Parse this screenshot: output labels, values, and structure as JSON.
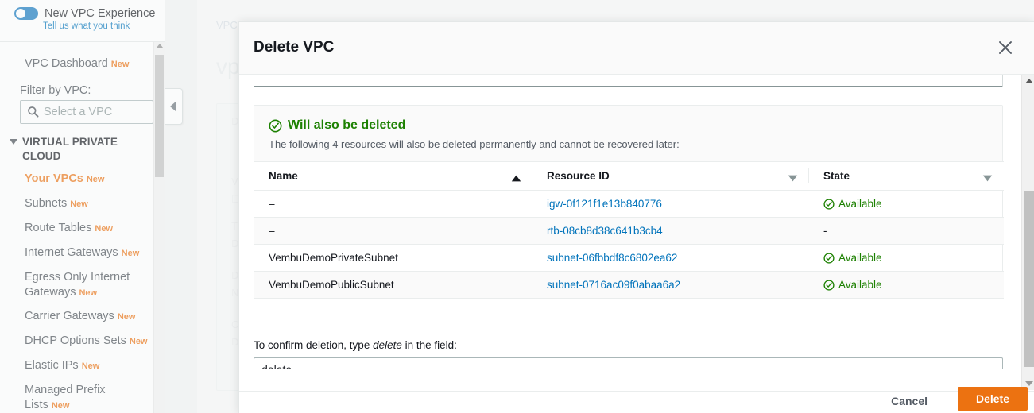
{
  "sidebar": {
    "new_experience": {
      "label": "New VPC Experience",
      "feedback_link": "Tell us what you think",
      "toggle_on": true,
      "toggle_color": "#1076bd"
    },
    "dashboard": {
      "label": "VPC Dashboard",
      "badge": "New"
    },
    "filter": {
      "label": "Filter by VPC:",
      "placeholder": "Select a VPC",
      "value": ""
    },
    "group": {
      "label": "VIRTUAL PRIVATE CLOUD"
    },
    "items": [
      {
        "label": "Your VPCs",
        "badge": "New",
        "selected": true
      },
      {
        "label": "Subnets",
        "badge": "New",
        "selected": false
      },
      {
        "label": "Route Tables",
        "badge": "New",
        "selected": false
      },
      {
        "label": "Internet Gateways",
        "badge": "New",
        "selected": false
      },
      {
        "label": "Egress Only Internet Gateways",
        "badge": "New",
        "selected": false
      },
      {
        "label": "Carrier Gateways",
        "badge": "New",
        "selected": false
      },
      {
        "label": "DHCP Options Sets",
        "badge": "New",
        "selected": false
      },
      {
        "label": "Elastic IPs",
        "badge": "New",
        "selected": false
      },
      {
        "label": "Managed Prefix Lists",
        "badge": "New",
        "selected": false
      }
    ]
  },
  "background": {
    "breadcrumb": "VPC",
    "page_title": "vp"
  },
  "modal": {
    "title": "Delete VPC",
    "close_label": "Close",
    "alert": {
      "heading": "Will also be deleted",
      "description": "The following 4 resources will also be deleted permanently and cannot be recovered later:",
      "accent_color": "#1d8102"
    },
    "table": {
      "columns": [
        {
          "label": "Name",
          "sort": "asc"
        },
        {
          "label": "Resource ID",
          "sort": "none"
        },
        {
          "label": "State",
          "sort": "none"
        }
      ],
      "rows": [
        {
          "name": "–",
          "resource_id": "igw-0f121f1e13b840776",
          "state": "Available",
          "state_ok": true
        },
        {
          "name": "–",
          "resource_id": "rtb-08cb8d38c641b3cb4",
          "state": "-",
          "state_ok": false
        },
        {
          "name": "VembuDemoPrivateSubnet",
          "resource_id": "subnet-06fbbdf8c6802ea62",
          "state": "Available",
          "state_ok": true
        },
        {
          "name": "VembuDemoPublicSubnet",
          "resource_id": "subnet-0716ac09f0abaa6a2",
          "state": "Available",
          "state_ok": true
        }
      ]
    },
    "confirm": {
      "label_before": "To confirm deletion, type ",
      "label_emphasis": "delete",
      "label_after": " in the field:",
      "input_value": "delete",
      "input_placeholder": "delete"
    },
    "footer": {
      "cancel_label": "Cancel",
      "delete_label": "Delete",
      "delete_color": "#ec7211"
    }
  }
}
